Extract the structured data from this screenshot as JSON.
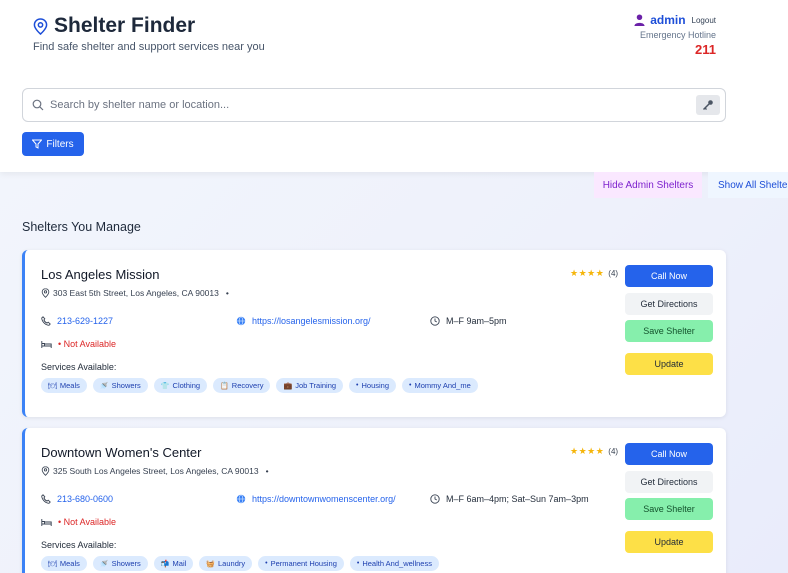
{
  "header": {
    "title": "Shelter Finder",
    "subtitle": "Find safe shelter and support services near you",
    "user": "admin",
    "logout": "Logout",
    "hotline_label": "Emergency Hotline",
    "hotline_number": "211"
  },
  "search": {
    "placeholder": "Search by shelter name or location..."
  },
  "filters_label": "Filters",
  "admin_toggle_label": "Hide Admin Shelters",
  "show_all_label": "Show All Shelters",
  "section_title": "Shelters You Manage",
  "colors": {
    "primary": "#2563eb",
    "danger": "#dc2626",
    "save": "#86efac",
    "update": "#fde047",
    "accent_border": "#3b82f6"
  },
  "labels": {
    "services": "Services Available:",
    "call": "Call Now",
    "directions": "Get Directions",
    "save": "Save Shelter",
    "update": "Update",
    "stars": "★★★★"
  },
  "shelters": [
    {
      "name": "Los Angeles Mission",
      "address": "303 East 5th Street, Los Angeles, CA 90013",
      "phone": "213-629-1227",
      "website": "https://losangelesmission.org/",
      "hours": "M–F 9am–5pm",
      "availability": "• Not Available",
      "rating_count": "(4)",
      "services": [
        {
          "icon": "🍽",
          "label": "Meals"
        },
        {
          "icon": "🚿",
          "label": "Showers"
        },
        {
          "icon": "👕",
          "label": "Clothing"
        },
        {
          "icon": "📋",
          "label": "Recovery"
        },
        {
          "icon": "💼",
          "label": "Job Training"
        },
        {
          "icon": "•",
          "label": "Housing"
        },
        {
          "icon": "•",
          "label": "Mommy And_me"
        }
      ]
    },
    {
      "name": "Downtown Women's Center",
      "address": "325 South Los Angeles Street, Los Angeles, CA 90013",
      "phone": "213-680-0600",
      "website": "https://downtownwomenscenter.org/",
      "hours": "M–F 6am–4pm; Sat–Sun 7am–3pm",
      "availability": "• Not Available",
      "rating_count": "(4)",
      "services": [
        {
          "icon": "🍽",
          "label": "Meals"
        },
        {
          "icon": "🚿",
          "label": "Showers"
        },
        {
          "icon": "📬",
          "label": "Mail"
        },
        {
          "icon": "🧺",
          "label": "Laundry"
        },
        {
          "icon": "•",
          "label": "Permanent Housing"
        },
        {
          "icon": "•",
          "label": "Health And_wellness"
        }
      ]
    }
  ]
}
